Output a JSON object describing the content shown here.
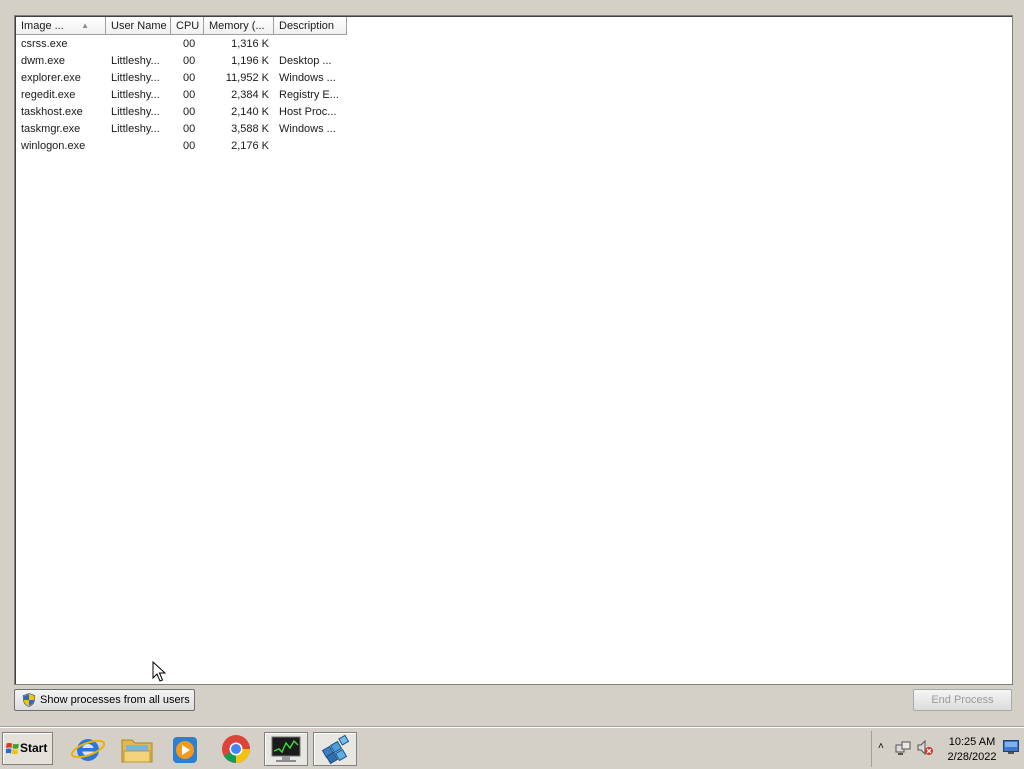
{
  "columns": [
    {
      "label": "Image ..."
    },
    {
      "label": "User Name"
    },
    {
      "label": "CPU"
    },
    {
      "label": "Memory (..."
    },
    {
      "label": "Description"
    }
  ],
  "processes": [
    {
      "image": "csrss.exe",
      "user": "",
      "cpu": "00",
      "memory": "1,316 K",
      "description": ""
    },
    {
      "image": "dwm.exe",
      "user": "Littleshy...",
      "cpu": "00",
      "memory": "1,196 K",
      "description": "Desktop ..."
    },
    {
      "image": "explorer.exe",
      "user": "Littleshy...",
      "cpu": "00",
      "memory": "11,952 K",
      "description": "Windows ..."
    },
    {
      "image": "regedit.exe",
      "user": "Littleshy...",
      "cpu": "00",
      "memory": "2,384 K",
      "description": "Registry E..."
    },
    {
      "image": "taskhost.exe",
      "user": "Littleshy...",
      "cpu": "00",
      "memory": "2,140 K",
      "description": "Host Proc..."
    },
    {
      "image": "taskmgr.exe",
      "user": "Littleshy...",
      "cpu": "00",
      "memory": "3,588 K",
      "description": "Windows ..."
    },
    {
      "image": "winlogon.exe",
      "user": "",
      "cpu": "00",
      "memory": "2,176 K",
      "description": ""
    }
  ],
  "buttons": {
    "show_all": "Show processes from all users",
    "end_process": "End Process"
  },
  "taskbar": {
    "start_label": "Start",
    "icons": [
      "internet-explorer-icon",
      "windows-explorer-icon",
      "media-player-icon",
      "chrome-icon",
      "task-manager-icon",
      "registry-editor-icon"
    ]
  },
  "tray": {
    "time": "10:25 AM",
    "date": "2/28/2022"
  },
  "colors": {
    "window_bg": "#d4d0c8",
    "list_bg": "#ffffff",
    "disabled_text": "#9a9a9a"
  }
}
